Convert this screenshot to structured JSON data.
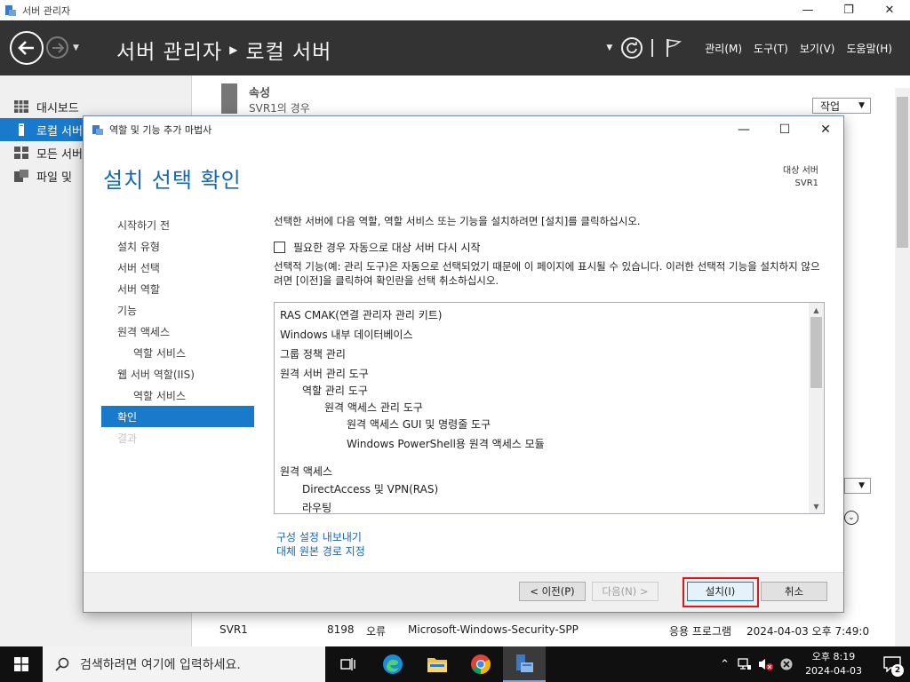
{
  "server_manager": {
    "window_title": "서버 관리자",
    "breadcrumb_root": "서버 관리자",
    "breadcrumb_current": "로컬 서버",
    "menu": [
      "관리(M)",
      "도구(T)",
      "보기(V)",
      "도움말(H)"
    ],
    "nav_items": [
      "대시보드",
      "로컬 서버",
      "모든 서버",
      "파일 및"
    ],
    "properties_title": "속성",
    "properties_sub": "SVR1의 경우",
    "tasks_label": "작업",
    "event_row": {
      "server": "SVR1",
      "id": "8198",
      "severity": "오류",
      "source": "Microsoft-Windows-Security-SPP",
      "log": "응용 프로그램",
      "datetime": "2024-04-03 오후 7:49:0"
    }
  },
  "wizard": {
    "title": "역할 및 기능 추가 마법사",
    "heading": "설치 선택 확인",
    "target_label": "대상 서버",
    "target_value": "SVR1",
    "steps": [
      {
        "label": "시작하기 전",
        "level": 0,
        "state": "normal"
      },
      {
        "label": "설치 유형",
        "level": 0,
        "state": "normal"
      },
      {
        "label": "서버 선택",
        "level": 0,
        "state": "normal"
      },
      {
        "label": "서버 역할",
        "level": 0,
        "state": "normal"
      },
      {
        "label": "기능",
        "level": 0,
        "state": "normal"
      },
      {
        "label": "원격 액세스",
        "level": 0,
        "state": "normal"
      },
      {
        "label": "역할 서비스",
        "level": 1,
        "state": "normal"
      },
      {
        "label": "웹 서버 역할(IIS)",
        "level": 0,
        "state": "normal"
      },
      {
        "label": "역할 서비스",
        "level": 1,
        "state": "normal"
      },
      {
        "label": "확인",
        "level": 0,
        "state": "active"
      },
      {
        "label": "결과",
        "level": 0,
        "state": "disabled"
      }
    ],
    "description": "선택한 서버에 다음 역할, 역할 서비스 또는 기능을 설치하려면 [설치]를 클릭하십시오.",
    "restart_checkbox_label": "필요한 경우 자동으로 대상 서버 다시 시작",
    "restart_checked": false,
    "info_text": "선택적 기능(예: 관리 도구)은 자동으로 선택되었기 때문에 이 페이지에 표시될 수 있습니다. 이러한 선택적 기능을 설치하지 않으려면 [이전]을 클릭하여 확인란을 선택 취소하십시오.",
    "features": [
      {
        "label": "RAS CMAK(연결 관리자 관리 키트)",
        "indent": 0
      },
      {
        "label": "Windows 내부 데이터베이스",
        "indent": 0
      },
      {
        "label": "그룹 정책 관리",
        "indent": 0
      },
      {
        "label": "원격 서버 관리 도구",
        "indent": 0
      },
      {
        "label": "역할 관리 도구",
        "indent": 1
      },
      {
        "label": "원격 액세스 관리 도구",
        "indent": 2
      },
      {
        "label": "원격 액세스 GUI 및 명령줄 도구",
        "indent": 3
      },
      {
        "label": "Windows PowerShell용 원격 액세스 모듈",
        "indent": 3
      },
      {
        "label": "원격 액세스",
        "indent": 0
      },
      {
        "label": "DirectAccess 및 VPN(RAS)",
        "indent": 1
      },
      {
        "label": "라우팅",
        "indent": 1
      }
    ],
    "link_export": "구성 설정 내보내기",
    "link_alt_source": "대체 원본 경로 지정",
    "buttons": {
      "prev": "< 이전(P)",
      "next": "다음(N) >",
      "install": "설치(I)",
      "cancel": "취소"
    }
  },
  "taskbar": {
    "search_placeholder": "검색하려면 여기에 입력하세요.",
    "time": "오후 8:19",
    "date": "2024-04-03",
    "notification_count": "2"
  },
  "colors": {
    "accent": "#1979ca",
    "heading": "#1667b6",
    "header_bg": "#333333",
    "highlight_box": "#e0161c"
  }
}
